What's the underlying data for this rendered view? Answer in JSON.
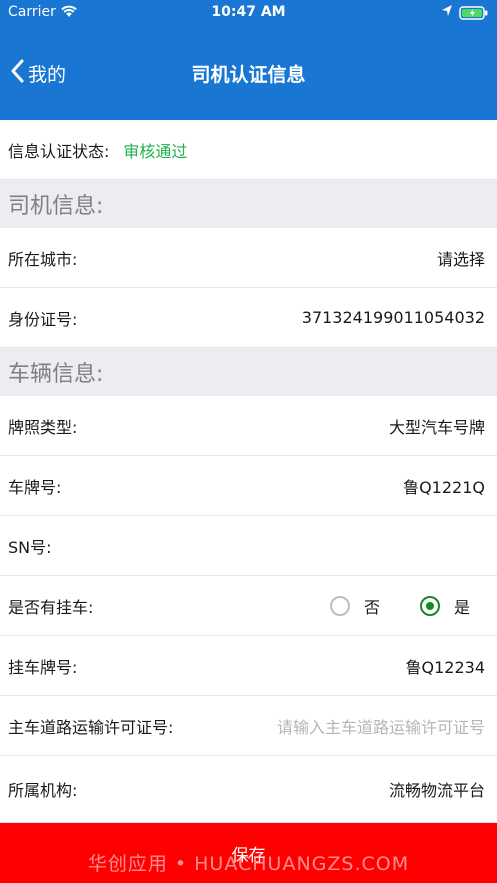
{
  "status_bar": {
    "carrier": "Carrier",
    "time": "10:47 AM"
  },
  "nav": {
    "back_label": "我的",
    "title": "司机认证信息"
  },
  "verify": {
    "label": "信息认证状态:",
    "value": "审核通过",
    "value_color": "#22b14c"
  },
  "driver_section": {
    "title": "司机信息:"
  },
  "driver_rows": [
    {
      "label": "所在城市:",
      "value": "请选择"
    },
    {
      "label": "身份证号:",
      "value": "371324199011054032"
    }
  ],
  "vehicle_section": {
    "title": "车辆信息:"
  },
  "vehicle_rows": [
    {
      "label": "牌照类型:",
      "value": "大型汽车号牌"
    },
    {
      "label": "车牌号:",
      "value": "鲁Q1221Q"
    },
    {
      "label": "SN号:",
      "value": ""
    }
  ],
  "trailer": {
    "label": "是否有挂车:",
    "options": [
      {
        "label": "否",
        "selected": false
      },
      {
        "label": "是",
        "selected": true
      }
    ]
  },
  "trailer_plate": {
    "label": "挂车牌号:",
    "value": "鲁Q12234"
  },
  "permit": {
    "label": "主车道路运输许可证号:",
    "placeholder": "请输入主车道路运输许可证号"
  },
  "org": {
    "label": "所属机构:",
    "value": "流畅物流平台"
  },
  "save_label": "保存",
  "watermark": "华创应用 • HUACHUANGZS.COM",
  "colors": {
    "header": "#1976d2",
    "save": "#ff0000",
    "radio_selected": "#138a22"
  }
}
